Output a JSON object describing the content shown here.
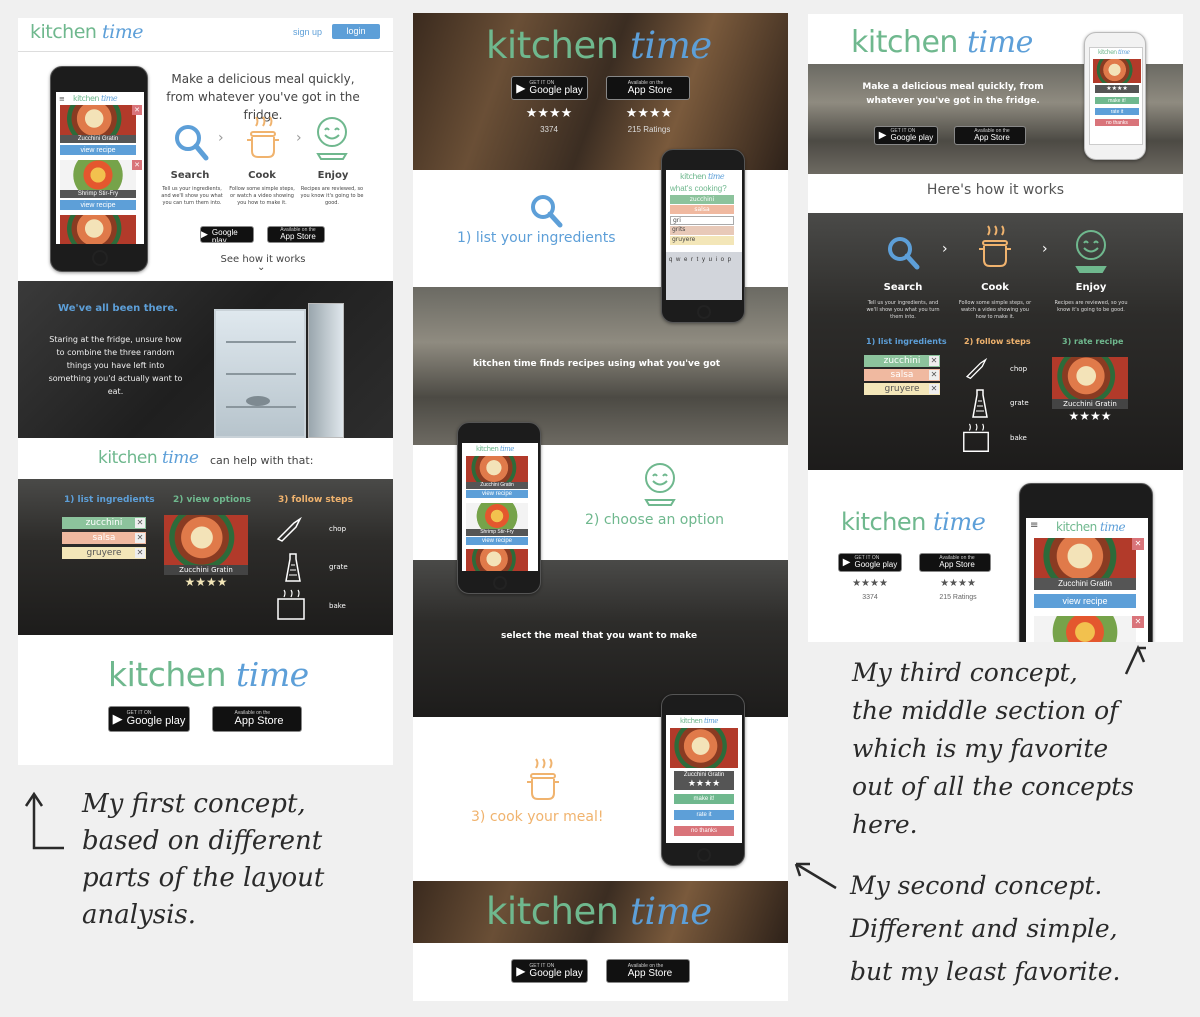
{
  "brand": {
    "kitchen": "kitchen",
    "time": "time"
  },
  "colors": {
    "green": "#6fb88e",
    "blue": "#5d9fd8",
    "orange": "#f0b36e",
    "red": "#d9747a",
    "note": "#2a2a2a"
  },
  "stores": {
    "google_small": "GET IT ON",
    "google": "Google play",
    "apple_small": "Available on the",
    "apple": "App Store"
  },
  "icons": [
    "search-icon",
    "pot-icon",
    "smiley-icon",
    "chevron-right-icon",
    "chevron-down-icon",
    "knife-icon",
    "grater-icon",
    "oven-icon",
    "arrow-up-icon",
    "arrow-left-icon",
    "star-icon",
    "close-icon",
    "menu-icon"
  ],
  "c1": {
    "signup": "sign up",
    "login": "login",
    "headline": "Make a delicious meal quickly, from whatever you've got in the fridge.",
    "steps": [
      {
        "title": "Search",
        "desc": "Tell us your ingredients, and we'll show you what you can turn them into."
      },
      {
        "title": "Cook",
        "desc": "Follow some simple steps, or watch a video showing you how to make it."
      },
      {
        "title": "Enjoy",
        "desc": "Recipes are reviewed, so you know it's going to be good."
      }
    ],
    "see_how": "See how it works",
    "phone": {
      "r1": "Zucchini Gratin",
      "r2": "Shrimp Stir-Fry",
      "view": "view recipe"
    },
    "been_there": "We've all been there.",
    "fridge_text": "Staring at the fridge, unsure how to combine the three random things you have left into something you'd actually want to eat.",
    "can_help": "can help with that:",
    "h1": "1) list ingredients",
    "h2": "2) view options",
    "h3": "3) follow steps",
    "ingredients": [
      "zucchini",
      "salsa",
      "gruyere"
    ],
    "recipe": "Zucchini Gratin",
    "stars": "★★★★",
    "actions": [
      "chop",
      "grate",
      "bake"
    ]
  },
  "c2": {
    "ratings": [
      {
        "stars": "★★★★",
        "count": "3374"
      },
      {
        "stars": "★★★★",
        "count": "215 Ratings"
      }
    ],
    "s1": "1) list your ingredients",
    "finds": "kitchen time finds recipes using what you've got",
    "s2": "2) choose an option",
    "select": "select the meal that you want to make",
    "s3": "3) cook your meal!",
    "phone1": {
      "question": "what's cooking?",
      "tags": [
        "zucchini",
        "salsa",
        "gri",
        "grits",
        "gruyere"
      ],
      "keys": "q w e r t y u i o p"
    },
    "phone3": {
      "recipe": "Zucchini Gratin",
      "make": "make it!",
      "rate": "rate it",
      "no": "no thanks"
    }
  },
  "c3": {
    "headline": "Make a delicious meal quickly, from whatever you've got in the fridge.",
    "how": "Here's how it works",
    "steps": [
      "Search",
      "Cook",
      "Enjoy"
    ],
    "descs": [
      "Tell us your ingredients, and we'll show you what you turn them into.",
      "Follow some simple steps, or watch a video showing you how to make it.",
      "Recipes are reviewed, so you know it's going to be good."
    ],
    "h1": "1) list ingredients",
    "h2": "2) follow steps",
    "h3": "3) rate recipe",
    "ratings": [
      {
        "stars": "★★★★",
        "count": "3374"
      },
      {
        "stars": "★★★★",
        "count": "215 Ratings"
      }
    ]
  },
  "notes": {
    "first": "My first concept,\nbased on different\nparts of the layout\nanalysis.",
    "third": "My third concept,\nthe middle section of\nwhich is my favorite\nout of all the concepts\nhere.",
    "second": "My second concept.\nDifferent and simple,\nbut my least favorite."
  }
}
